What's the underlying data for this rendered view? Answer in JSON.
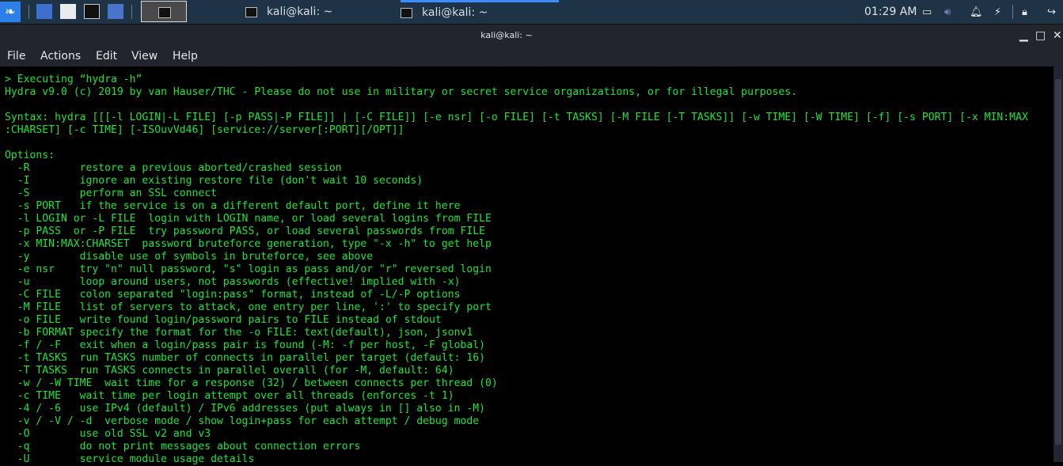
{
  "taskbar": {
    "tasks": [
      {
        "label": "kali@kali: ~"
      },
      {
        "label": "kali@kali: ~"
      }
    ],
    "clock": "01:29 AM"
  },
  "window": {
    "title": "kali@kali: ~"
  },
  "menu": [
    "File",
    "Actions",
    "Edit",
    "View",
    "Help"
  ],
  "terminal": {
    "lines": [
      "> Executing “hydra -h”",
      "Hydra v9.0 (c) 2019 by van Hauser/THC - Please do not use in military or secret service organizations, or for illegal purposes.",
      "",
      "Syntax: hydra [[[-l LOGIN|-L FILE] [-p PASS|-P FILE]] | [-C FILE]] [-e nsr] [-o FILE] [-t TASKS] [-M FILE [-T TASKS]] [-w TIME] [-W TIME] [-f] [-s PORT] [-x MIN:MAX",
      ":CHARSET] [-c TIME] [-ISOuvVd46] [service://server[:PORT][/OPT]]",
      "",
      "Options:",
      "  -R        restore a previous aborted/crashed session",
      "  -I        ignore an existing restore file (don't wait 10 seconds)",
      "  -S        perform an SSL connect",
      "  -s PORT   if the service is on a different default port, define it here",
      "  -l LOGIN or -L FILE  login with LOGIN name, or load several logins from FILE",
      "  -p PASS  or -P FILE  try password PASS, or load several passwords from FILE",
      "  -x MIN:MAX:CHARSET  password bruteforce generation, type \"-x -h\" to get help",
      "  -y        disable use of symbols in bruteforce, see above",
      "  -e nsr    try \"n\" null password, \"s\" login as pass and/or \"r\" reversed login",
      "  -u        loop around users, not passwords (effective! implied with -x)",
      "  -C FILE   colon separated \"login:pass\" format, instead of -L/-P options",
      "  -M FILE   list of servers to attack, one entry per line, ':' to specify port",
      "  -o FILE   write found login/password pairs to FILE instead of stdout",
      "  -b FORMAT specify the format for the -o FILE: text(default), json, jsonv1",
      "  -f / -F   exit when a login/pass pair is found (-M: -f per host, -F global)",
      "  -t TASKS  run TASKS number of connects in parallel per target (default: 16)",
      "  -T TASKS  run TASKS connects in parallel overall (for -M, default: 64)",
      "  -w / -W TIME  wait time for a response (32) / between connects per thread (0)",
      "  -c TIME   wait time per login attempt over all threads (enforces -t 1)",
      "  -4 / -6   use IPv4 (default) / IPv6 addresses (put always in [] also in -M)",
      "  -v / -V / -d  verbose mode / show login+pass for each attempt / debug mode",
      "  -O        use old SSL v2 and v3",
      "  -q        do not print messages about connection errors",
      "  -U        service module usage details"
    ]
  }
}
